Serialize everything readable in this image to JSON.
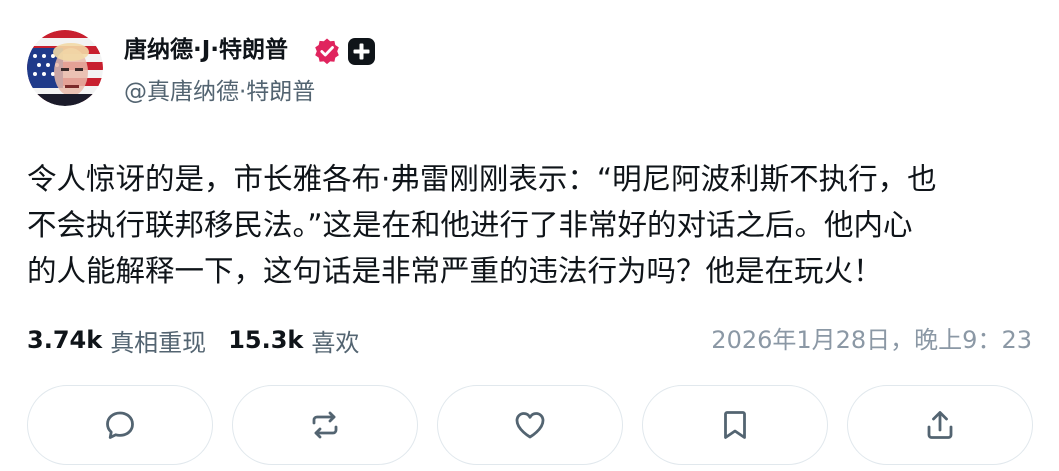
{
  "author": {
    "display_name": "唐纳德·J·特朗普",
    "handle": "@真唐纳德·特朗普",
    "avatar_icon": "avatar-flag-portrait",
    "verified_color": "#e0245e"
  },
  "post": {
    "lines": [
      "令人惊讶的是，市长雅各布·弗雷刚刚表示：“明尼阿波利斯不执行，也",
      "不会执行联邦移民法。”这是在和他进行了非常好的对话之后。他内心",
      "的人能解释一下，这句话是非常严重的违法行为吗？他是在玩火！"
    ]
  },
  "stats": {
    "reposts_count": "3.74k",
    "reposts_label": "真相重现",
    "likes_count": "15.3k",
    "likes_label": "喜欢",
    "timestamp": "2026年1月28日，晚上9：23"
  },
  "actions": [
    {
      "icon": "reply-icon"
    },
    {
      "icon": "repost-icon"
    },
    {
      "icon": "like-icon"
    },
    {
      "icon": "bookmark-icon"
    },
    {
      "icon": "share-icon"
    }
  ],
  "colors": {
    "text_primary": "#0f1419",
    "text_secondary": "#536471",
    "timestamp": "#8b98a5",
    "button_border": "#e1e8ed",
    "icon": "#536471"
  }
}
